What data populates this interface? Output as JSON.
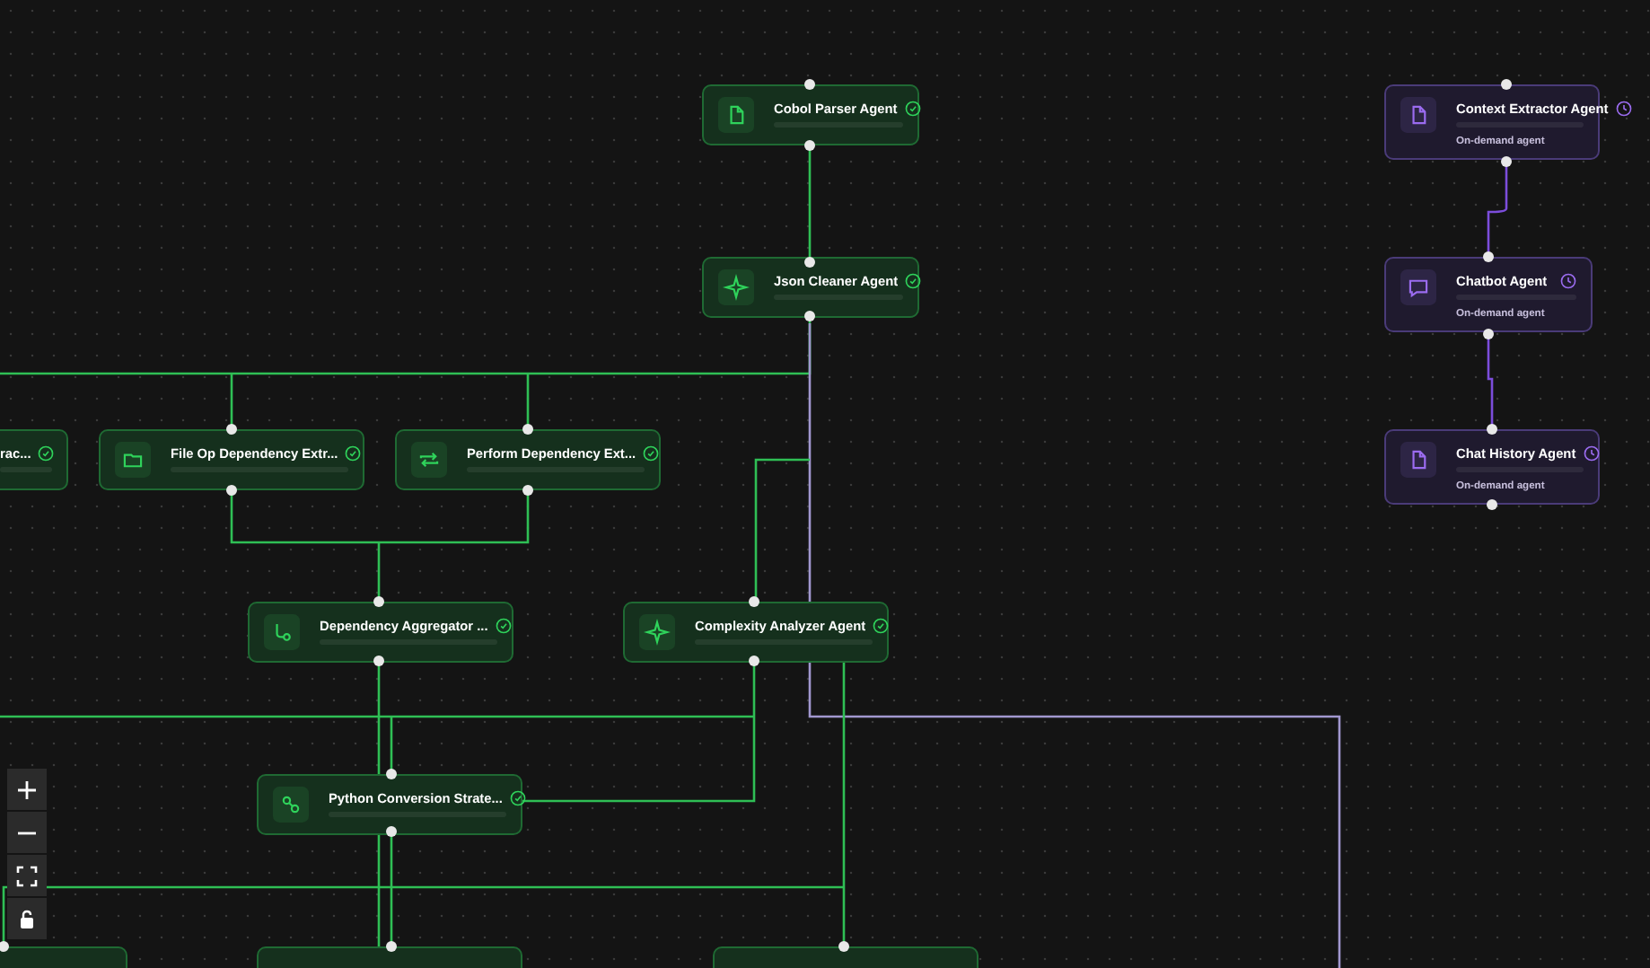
{
  "nodes": [
    {
      "label": "Cobol Parser Agent",
      "kind": "completed"
    },
    {
      "label": "Json Cleaner Agent",
      "kind": "completed"
    },
    {
      "label": "rac...",
      "kind": "completed"
    },
    {
      "label": "File Op Dependency Extr...",
      "kind": "completed"
    },
    {
      "label": "Perform Dependency Ext...",
      "kind": "completed"
    },
    {
      "label": "Dependency Aggregator ...",
      "kind": "completed"
    },
    {
      "label": "Complexity Analyzer Agent",
      "kind": "completed"
    },
    {
      "label": "Python Conversion Strate...",
      "kind": "completed"
    },
    {
      "label": "Context Extractor Agent",
      "kind": "on_demand",
      "subtitle": "On-demand agent"
    },
    {
      "label": "Chatbot Agent",
      "kind": "on_demand",
      "subtitle": "On-demand agent"
    },
    {
      "label": "Chat History Agent",
      "kind": "on_demand",
      "subtitle": "On-demand agent"
    }
  ],
  "controls": [
    {
      "kind": "zoom_in"
    },
    {
      "kind": "zoom_out"
    },
    {
      "kind": "fit"
    },
    {
      "kind": "lock"
    }
  ]
}
